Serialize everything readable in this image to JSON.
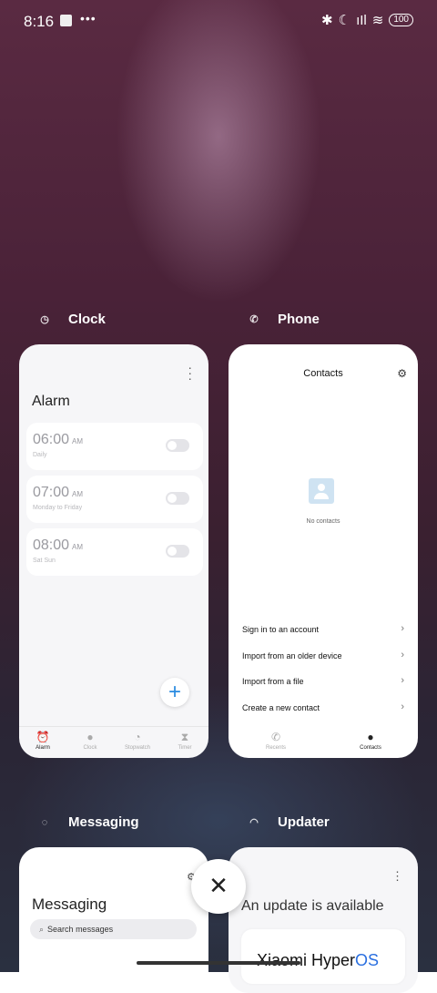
{
  "status_bar": {
    "time": "8:16",
    "dots": "•••",
    "battery": "100"
  },
  "apps": [
    {
      "label": "Clock"
    },
    {
      "label": "Phone"
    },
    {
      "label": "Messaging"
    },
    {
      "label": "Updater"
    }
  ],
  "clock": {
    "title": "Alarm",
    "alarms": [
      {
        "time": "06:00",
        "ampm": "AM",
        "repeat": "Daily",
        "enabled": false
      },
      {
        "time": "07:00",
        "ampm": "AM",
        "repeat": "Monday to Friday",
        "enabled": false
      },
      {
        "time": "08:00",
        "ampm": "AM",
        "repeat": "Sat Sun",
        "enabled": false
      }
    ],
    "tabs": [
      "Alarm",
      "Clock",
      "Stopwatch",
      "Timer"
    ]
  },
  "phone": {
    "title": "Contacts",
    "empty_text": "No contacts",
    "actions": [
      "Sign in to an account",
      "Import from an older device",
      "Import from a file",
      "Create a new contact"
    ],
    "tabs": [
      "Recents",
      "Contacts"
    ]
  },
  "messaging": {
    "title": "Messaging",
    "search_placeholder": "Search messages"
  },
  "updater": {
    "title": "An update is available",
    "brand": "Xiaomi Hyper",
    "brand_os": "OS"
  }
}
